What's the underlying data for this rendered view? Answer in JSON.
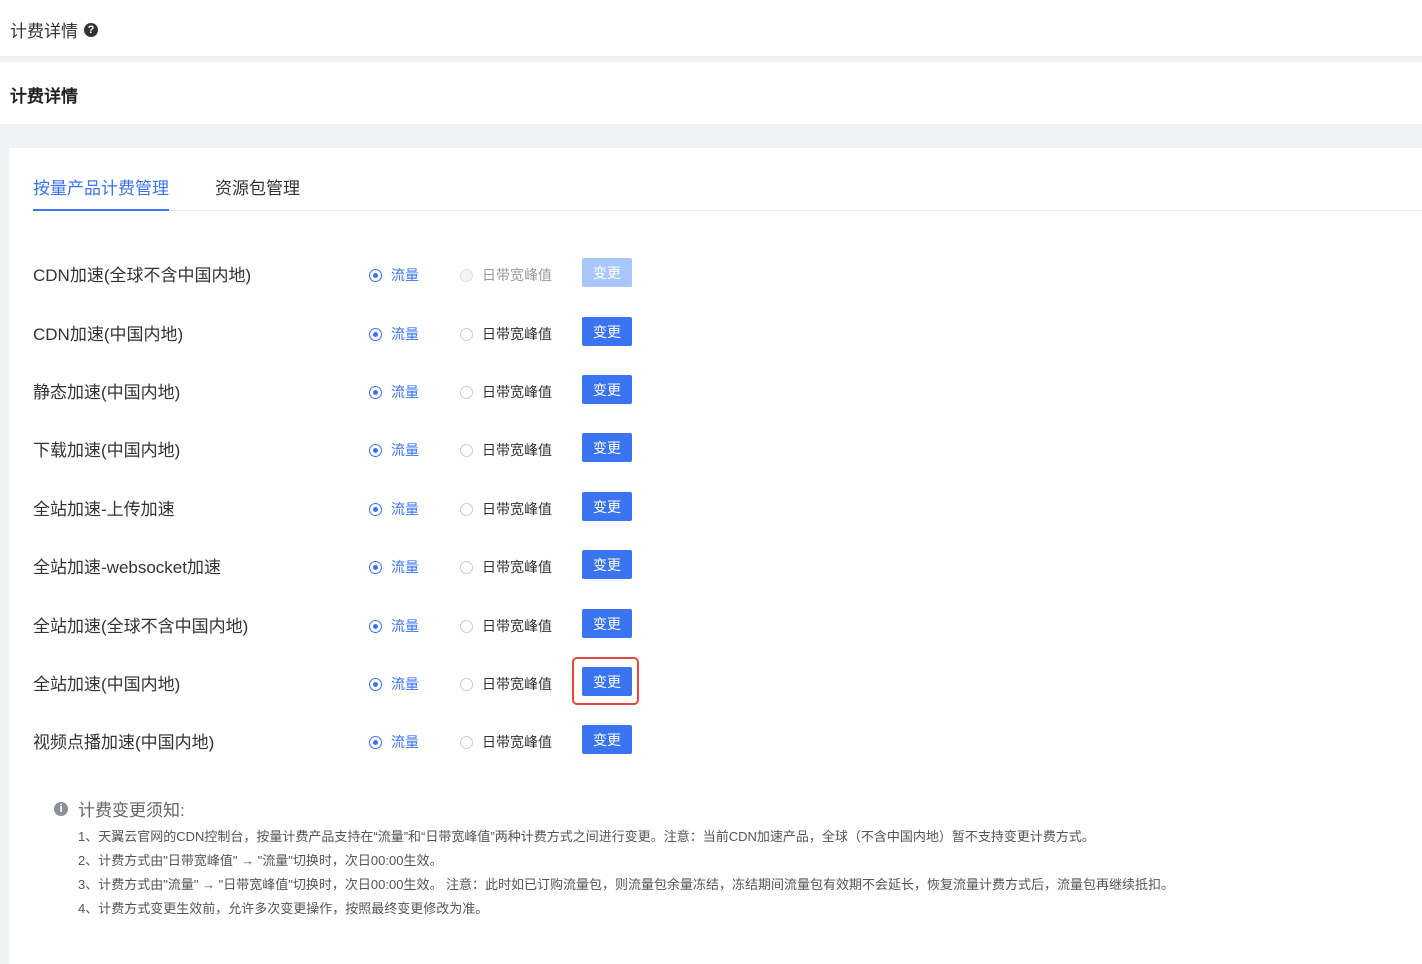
{
  "header": {
    "title": "计费详情",
    "help_icon": "?"
  },
  "subheader": {
    "title": "计费详情"
  },
  "tabs": [
    {
      "label": "按量产品计费管理",
      "active": true
    },
    {
      "label": "资源包管理",
      "active": false
    }
  ],
  "options": {
    "traffic": "流量",
    "bandwidth": "日带宽峰值",
    "change": "变更"
  },
  "rows": [
    {
      "label": "CDN加速(全球不含中国内地)",
      "disabled": true
    },
    {
      "label": "CDN加速(中国内地)"
    },
    {
      "label": "静态加速(中国内地)"
    },
    {
      "label": "下载加速(中国内地)"
    },
    {
      "label": "全站加速-上传加速"
    },
    {
      "label": "全站加速-websocket加速"
    },
    {
      "label": "全站加速(全球不含中国内地)"
    },
    {
      "label": "全站加速(中国内地)",
      "highlighted": true
    },
    {
      "label": "视频点播加速(中国内地)"
    }
  ],
  "notice": {
    "title": "计费变更须知:",
    "icon": "i",
    "lines": [
      "1、天翼云官网的CDN控制台，按量计费产品支持在“流量”和“日带宽峰值”两种计费方式之间进行变更。注意：当前CDN加速产品，全球（不含中国内地）暂不支持变更计费方式。",
      "2、计费方式由\"日带宽峰值\" → \"流量\"切换时，次日00:00生效。",
      "3、计费方式由\"流量\" → \"日带宽峰值\"切换时，次日00:00生效。 注意：此时如已订购流量包，则流量包余量冻结，冻结期间流量包有效期不会延长，恢复流量计费方式后，流量包再继续抵扣。",
      "4、计费方式变更生效前，允许多次变更操作，按照最终变更修改为准。"
    ]
  },
  "colors": {
    "accent": "#3a74f0",
    "highlight": "#e5473d"
  }
}
